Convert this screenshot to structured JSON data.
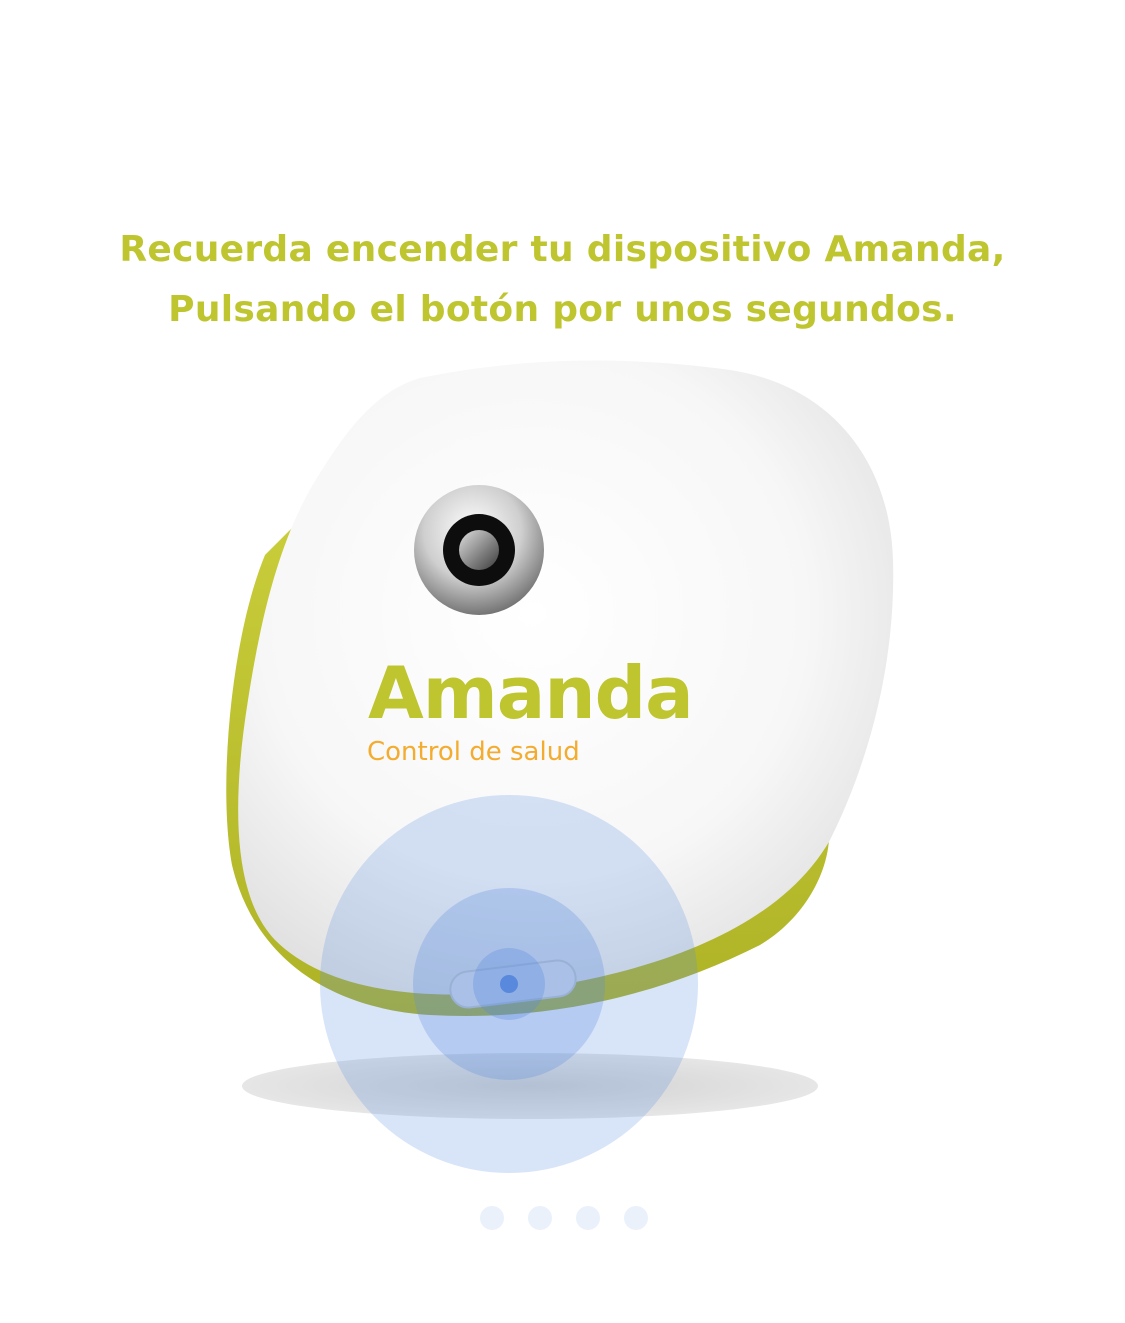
{
  "instruction": {
    "line1": "Recuerda encender tu dispositivo Amanda,",
    "line2": "Pulsando el botón por unos segundos."
  },
  "device": {
    "brand": "Amanda",
    "tagline": "Control de salud",
    "icons": [
      "camera-lens-icon",
      "power-button-icon"
    ]
  },
  "pager": {
    "page_count": 4
  },
  "colors": {
    "instruction_text": "#bfc52f",
    "brand_green": "#bfc52f",
    "tagline_orange": "#f3ac2f",
    "press_indicator_blue": "#5b8de0",
    "pager_dot": "#ebf1fa"
  }
}
